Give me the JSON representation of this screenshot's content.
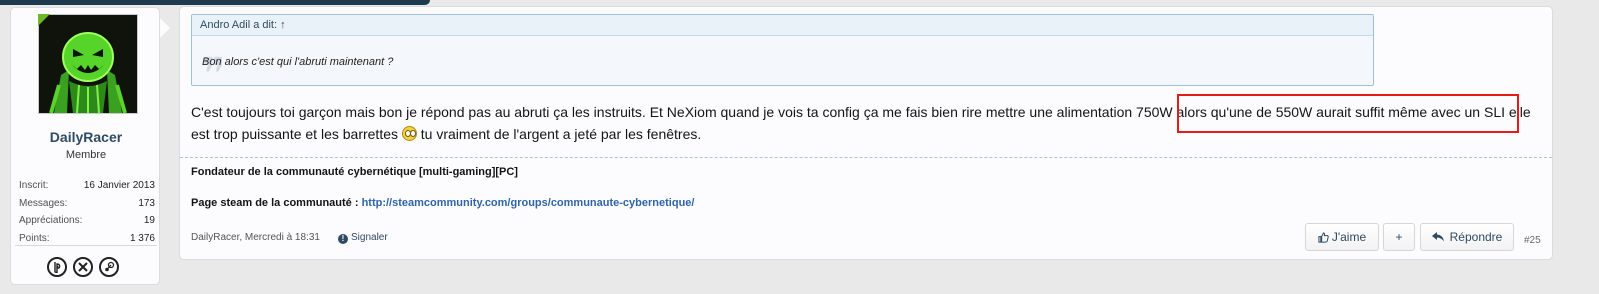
{
  "user": {
    "username": "DailyRacer",
    "title": "Membre",
    "stats": [
      {
        "label": "Inscrit:",
        "value": "16 Janvier 2013"
      },
      {
        "label": "Messages:",
        "value": "173"
      },
      {
        "label": "Appréciations:",
        "value": "19"
      },
      {
        "label": "Points:",
        "value": "1 376"
      }
    ],
    "platform_icons": [
      "playstation-icon",
      "xbox-icon",
      "steam-icon"
    ]
  },
  "quote": {
    "header": "Andro Adil a dit: ↑",
    "body": "Bon alors c'est qui l'abruti maintenant ?"
  },
  "message": {
    "line1": "C'est toujours toi garçon mais bon je répond pas au abruti ça les instruits. Et NeXiom quand je vois ta config ça me fais bien rire mettre une alimentation 750W alors qu'une de 550W aurait suffit même avec un SLI elle",
    "line2_before": "est trop puissante et les barrettes ",
    "line2_after": " tu vraiment de l'argent a jeté par les fenêtres."
  },
  "signature": {
    "line1": "Fondateur de la communauté cybernétique [multi-gaming][PC]",
    "line2_label": "Page steam de la communauté : ",
    "line2_link": "http://steamcommunity.com/groups/communaute-cybernetique/"
  },
  "meta": {
    "author_date": "DailyRacer, Mercredi à 18:31",
    "report": "Signaler",
    "report_icon_glyph": "!"
  },
  "actions": {
    "like": "J'aime",
    "plus": "+",
    "reply": "Répondre",
    "post_number": "#25"
  },
  "colors": {
    "highlight": "#e41b17",
    "username": "#2f4b63",
    "link": "#2f64a8",
    "online": "#6fb82a"
  }
}
